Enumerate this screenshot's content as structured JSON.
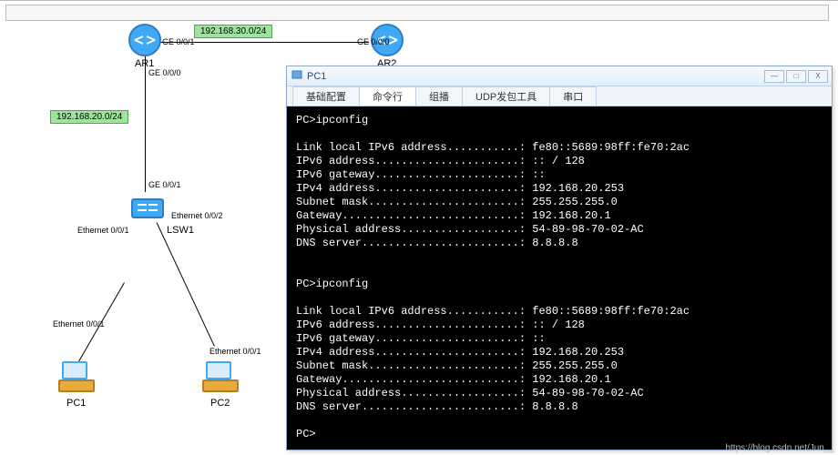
{
  "watermark": "https://blog.csdn.net/Jun__",
  "topology": {
    "subnets": {
      "ar1_ar2": "192.168.30.0/24",
      "ar1_lsw1": "192.168.20.0/24"
    },
    "devices": {
      "ar1": "AR1",
      "ar2": "AR2",
      "lsw1": "LSW1",
      "pc1": "PC1",
      "pc2": "PC2"
    },
    "ports": {
      "ar1_right": "GE 0/0/1",
      "ar1_down": "GE 0/0/0",
      "ar2_left": "GE 0/0/0",
      "lsw1_up": "GE 0/0/1",
      "lsw1_left": "Ethernet 0/0/1",
      "lsw1_right": "Ethernet 0/0/2",
      "pc1_up": "Ethernet 0/0/1",
      "pc2_up": "Ethernet 0/0/1"
    }
  },
  "window": {
    "title": "PC1",
    "tabs": [
      {
        "label": "基础配置",
        "active": false
      },
      {
        "label": "命令行",
        "active": true
      },
      {
        "label": "组播",
        "active": false
      },
      {
        "label": "UDP发包工具",
        "active": false
      },
      {
        "label": "串口",
        "active": false
      }
    ],
    "buttons": {
      "min": "—",
      "box": "□",
      "close": "X"
    },
    "term_lines": [
      "PC>ipconfig",
      "",
      "Link local IPv6 address...........: fe80::5689:98ff:fe70:2ac",
      "IPv6 address......................: :: / 128",
      "IPv6 gateway......................: ::",
      "IPv4 address......................: 192.168.20.253",
      "Subnet mask.......................: 255.255.255.0",
      "Gateway...........................: 192.168.20.1",
      "Physical address..................: 54-89-98-70-02-AC",
      "DNS server........................: 8.8.8.8",
      "",
      "",
      "PC>ipconfig",
      "",
      "Link local IPv6 address...........: fe80::5689:98ff:fe70:2ac",
      "IPv6 address......................: :: / 128",
      "IPv6 gateway......................: ::",
      "IPv4 address......................: 192.168.20.253",
      "Subnet mask.......................: 255.255.255.0",
      "Gateway...........................: 192.168.20.1",
      "Physical address..................: 54-89-98-70-02-AC",
      "DNS server........................: 8.8.8.8",
      "",
      "PC>"
    ]
  }
}
